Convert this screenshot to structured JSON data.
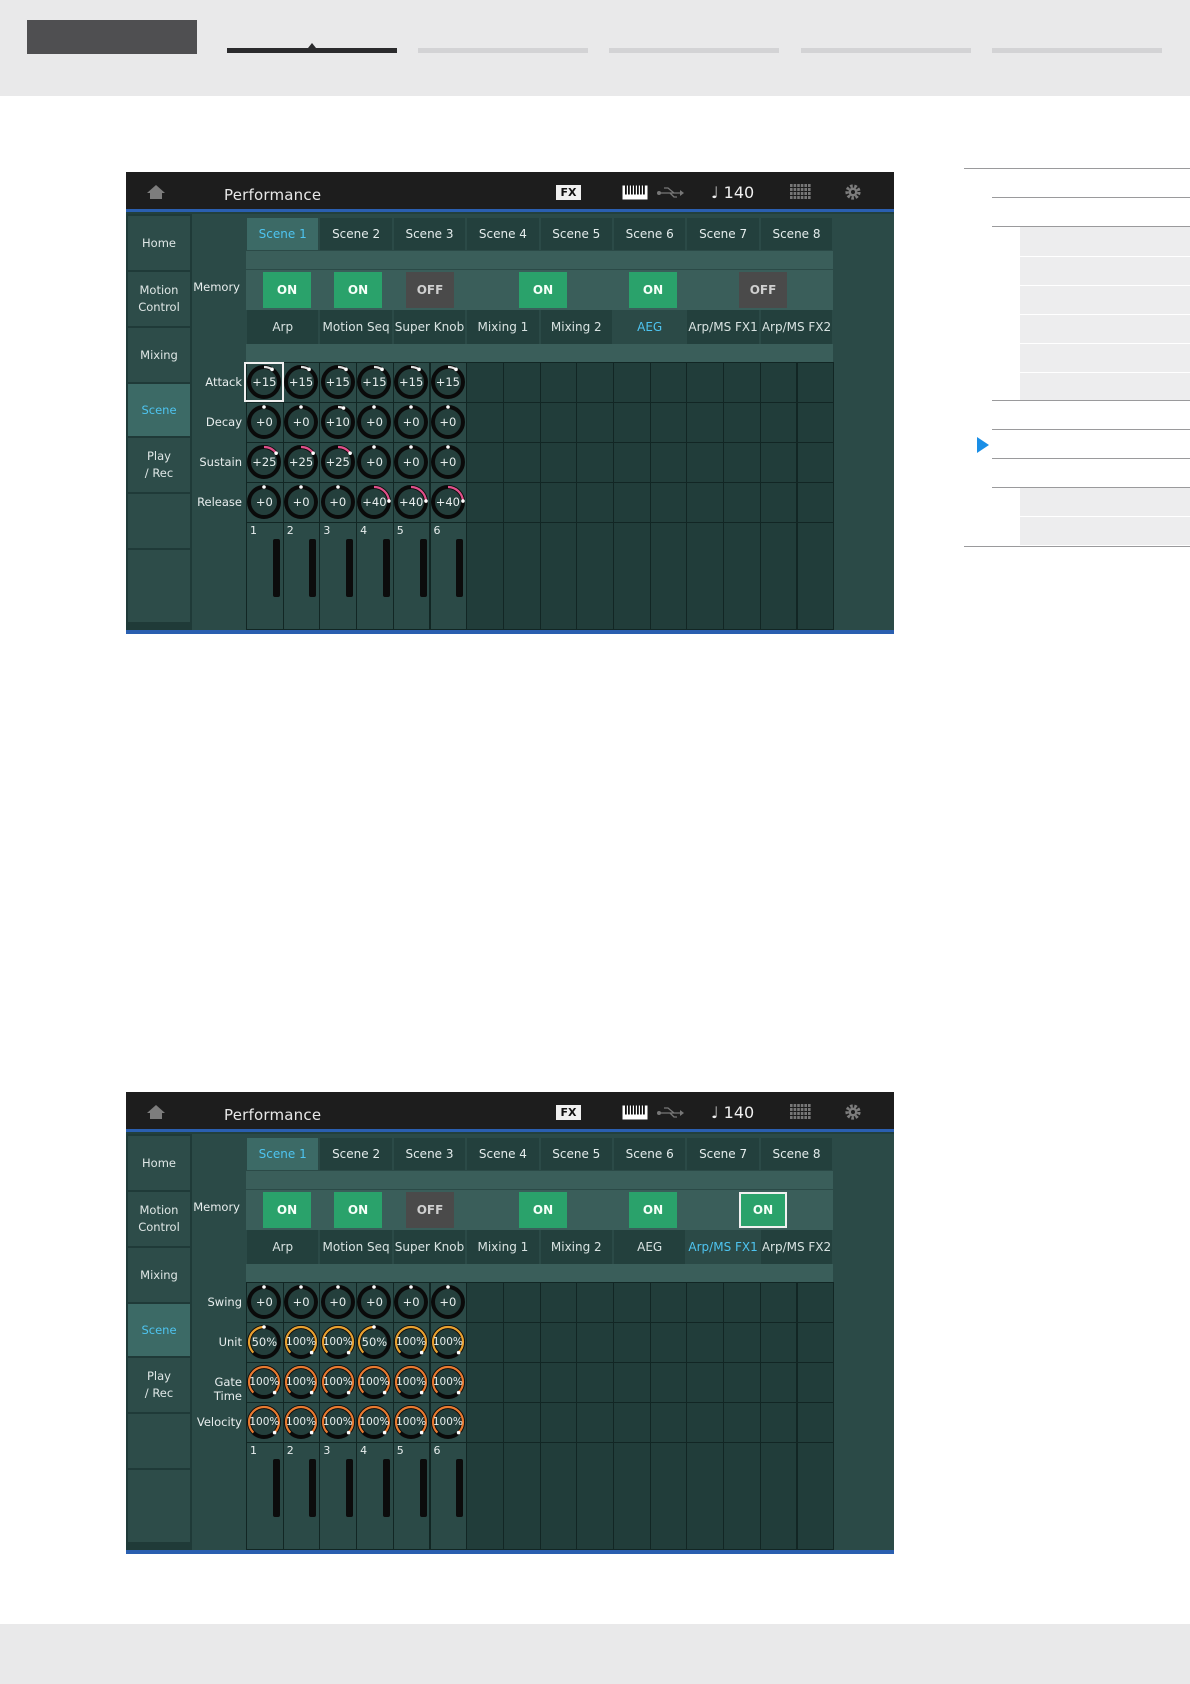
{
  "header": {
    "nav_tabs": [
      "tab-1",
      "tab-2",
      "tab-3",
      "tab-4",
      "tab-5"
    ]
  },
  "screens": [
    {
      "title": "Performance",
      "fx": "FX",
      "tempo": "♩ 140",
      "side": [
        "Home",
        "Motion\nControl",
        "Mixing",
        "Scene",
        "Play\n/ Rec"
      ],
      "side_active": 3,
      "scenes": [
        "Scene 1",
        "Scene 2",
        "Scene 3",
        "Scene 4",
        "Scene 5",
        "Scene 6",
        "Scene 7",
        "Scene 8"
      ],
      "scene_active": 0,
      "memory_label": "Memory",
      "memory": [
        {
          "state": "ON",
          "kind": "on"
        },
        {
          "state": "ON",
          "kind": "on"
        },
        {
          "state": "OFF",
          "kind": "off"
        },
        {
          "state": "ON",
          "kind": "on"
        },
        {
          "state": "ON",
          "kind": "on"
        },
        {
          "state": "OFF",
          "kind": "off"
        }
      ],
      "categories": [
        "Arp",
        "Motion Seq",
        "Super Knob",
        "Mixing 1",
        "Mixing 2",
        "AEG",
        "Arp/MS FX1",
        "Arp/MS FX2"
      ],
      "category_active": 5,
      "rows": [
        {
          "label": "Attack",
          "values": [
            "+15",
            "+15",
            "+15",
            "+15",
            "+15",
            "+15"
          ],
          "level": [
            0.62,
            0.62,
            0.62,
            0.62,
            0.62,
            0.62
          ],
          "color": "#e0e0e0"
        },
        {
          "label": "Decay",
          "values": [
            "+0",
            "+0",
            "+10",
            "+0",
            "+0",
            "+0"
          ],
          "level": [
            0.5,
            0.5,
            0.58,
            0.5,
            0.5,
            0.5
          ],
          "color": "#e0e0e0"
        },
        {
          "label": "Sustain",
          "values": [
            "+25",
            "+25",
            "+25",
            "+0",
            "+0",
            "+0"
          ],
          "level": [
            0.7,
            0.7,
            0.7,
            0.5,
            0.5,
            0.5
          ],
          "color": "#e0508a"
        },
        {
          "label": "Release",
          "values": [
            "+0",
            "+0",
            "+0",
            "+40",
            "+40",
            "+40"
          ],
          "level": [
            0.5,
            0.5,
            0.5,
            0.82,
            0.82,
            0.82
          ],
          "color": "#e0508a"
        }
      ],
      "selected_knob": [
        0,
        0
      ],
      "parts": [
        "1",
        "2",
        "3",
        "4",
        "5",
        "6"
      ]
    },
    {
      "title": "Performance",
      "fx": "FX",
      "tempo": "♩ 140",
      "side": [
        "Home",
        "Motion\nControl",
        "Mixing",
        "Scene",
        "Play\n/ Rec"
      ],
      "side_active": 3,
      "scenes": [
        "Scene 1",
        "Scene 2",
        "Scene 3",
        "Scene 4",
        "Scene 5",
        "Scene 6",
        "Scene 7",
        "Scene 8"
      ],
      "scene_active": 0,
      "memory_label": "Memory",
      "memory": [
        {
          "state": "ON",
          "kind": "on"
        },
        {
          "state": "ON",
          "kind": "on"
        },
        {
          "state": "OFF",
          "kind": "off"
        },
        {
          "state": "ON",
          "kind": "on"
        },
        {
          "state": "ON",
          "kind": "on"
        },
        {
          "state": "ON",
          "kind": "on",
          "selected": true
        }
      ],
      "categories": [
        "Arp",
        "Motion Seq",
        "Super Knob",
        "Mixing 1",
        "Mixing 2",
        "AEG",
        "Arp/MS FX1",
        "Arp/MS FX2"
      ],
      "category_active": 6,
      "rows": [
        {
          "label": "Swing",
          "values": [
            "+0",
            "+0",
            "+0",
            "+0",
            "+0",
            "+0"
          ],
          "level": [
            0.5,
            0.5,
            0.5,
            0.5,
            0.5,
            0.5
          ],
          "color": "#e0e0e0"
        },
        {
          "label": "Unit",
          "values": [
            "50%",
            "100%",
            "100%",
            "50%",
            "100%",
            "100%"
          ],
          "level": [
            0.5,
            1,
            1,
            0.5,
            1,
            1
          ],
          "color": "#e8a030"
        },
        {
          "label": "Gate Time",
          "values": [
            "100%",
            "100%",
            "100%",
            "100%",
            "100%",
            "100%"
          ],
          "level": [
            1,
            1,
            1,
            1,
            1,
            1
          ],
          "color": "#e87a30"
        },
        {
          "label": "Velocity",
          "values": [
            "100%",
            "100%",
            "100%",
            "100%",
            "100%",
            "100%"
          ],
          "level": [
            1,
            1,
            1,
            1,
            1,
            1
          ],
          "color": "#e87a30"
        }
      ],
      "selected_knob": null,
      "parts": [
        "1",
        "2",
        "3",
        "4",
        "5",
        "6"
      ]
    }
  ]
}
